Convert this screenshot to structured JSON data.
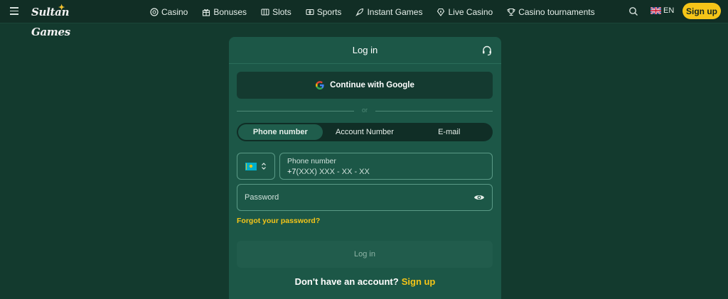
{
  "header": {
    "logo_text": "Sultan Games",
    "nav": [
      {
        "label": "Casino",
        "icon": "casino-chip-icon"
      },
      {
        "label": "Bonuses",
        "icon": "gift-icon"
      },
      {
        "label": "Slots",
        "icon": "slots-icon"
      },
      {
        "label": "Sports",
        "icon": "sports-icon"
      },
      {
        "label": "Instant Games",
        "icon": "rocket-icon"
      },
      {
        "label": "Live Casino",
        "icon": "live-casino-icon"
      },
      {
        "label": "Casino tournaments",
        "icon": "trophy-icon"
      }
    ],
    "language": "EN",
    "signup_label": "Sign up"
  },
  "modal": {
    "title": "Log in",
    "google_label": "Continue with Google",
    "divider_text": "or",
    "tabs": [
      {
        "label": "Phone number",
        "active": true
      },
      {
        "label": "Account Number",
        "active": false
      },
      {
        "label": "E-mail",
        "active": false
      }
    ],
    "phone": {
      "label": "Phone number",
      "prefix": "+7",
      "mask": "(XXX) XXX - XX - XX"
    },
    "password_placeholder": "Password",
    "forgot_label": "Forgot your password?",
    "login_label": "Log in",
    "no_account_text": "Don't have an account?",
    "signup_link": "Sign up"
  },
  "colors": {
    "background": "#133a2e",
    "header": "#112e25",
    "modal": "#1c5747",
    "accent": "#f5c518"
  }
}
